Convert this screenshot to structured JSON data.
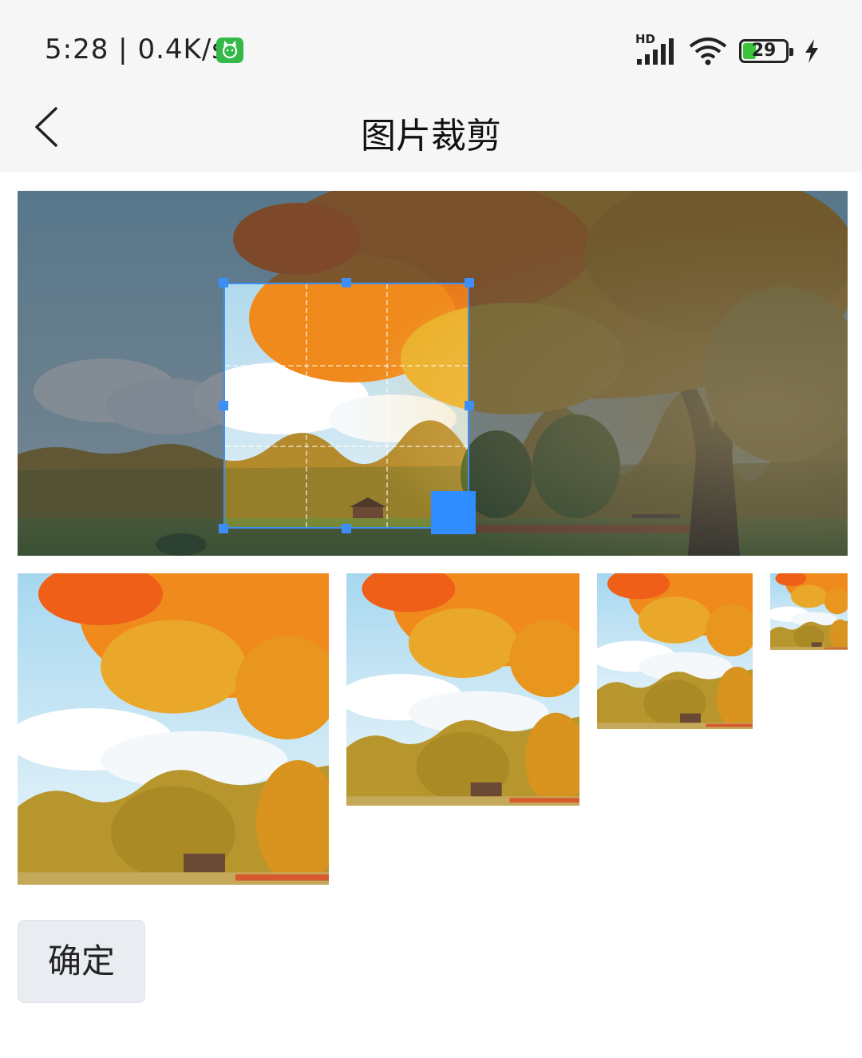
{
  "status_bar": {
    "time": "5:28",
    "separator": "|",
    "network_speed": "0.4K/s",
    "app_badge_icon": "cat-app-icon",
    "signal_label": "HD",
    "signal_icon": "cellular-signal-icon",
    "wifi_icon": "wifi-icon",
    "battery_level": "29",
    "charging_icon": "lightning-icon",
    "colors": {
      "app_badge": "#33b948",
      "battery_fill": "#3cc43c"
    }
  },
  "header": {
    "title": "图片裁剪",
    "back_icon": "chevron-left-icon"
  },
  "crop": {
    "image_description_icon": "autumn-tree-photo",
    "accent_color": "#3d8ef6",
    "resize_handle_color": "#2f8dff"
  },
  "previews": {
    "sizes": [
      "large",
      "medium",
      "small",
      "extra-small"
    ]
  },
  "actions": {
    "confirm_label": "确定"
  }
}
